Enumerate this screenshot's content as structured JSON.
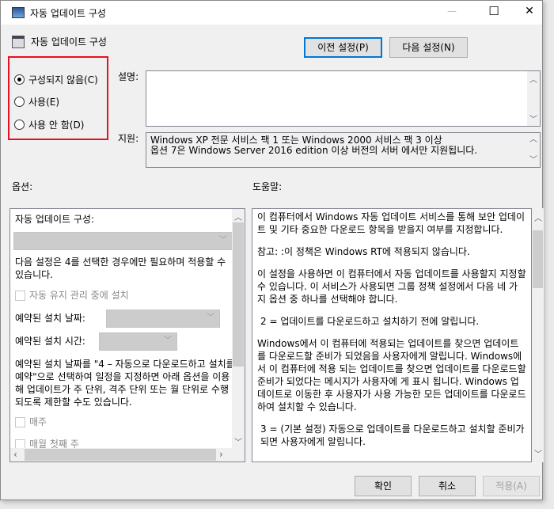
{
  "window": {
    "title": "자동 업데이트 구성",
    "minimize": "—",
    "maximize": "☐",
    "close": "✕"
  },
  "header": {
    "policy_name": "자동 업데이트 구성",
    "prev_button": "이전 설정(P)",
    "next_button": "다음 설정(N)"
  },
  "state": {
    "options": [
      {
        "label": "구성되지 않음(C)",
        "selected": true
      },
      {
        "label": "사용(E)",
        "selected": false
      },
      {
        "label": "사용 안 함(D)",
        "selected": false
      }
    ]
  },
  "description": {
    "label": "설명:",
    "value": ""
  },
  "support": {
    "label": "지원:",
    "lines": [
      "Windows XP 전문 서비스 팩 1 또는 Windows 2000 서비스 팩 3 이상",
      "옵션 7은 Windows Server 2016 edition 이상 버전의 서버 에서만 지원됩니다."
    ]
  },
  "options_panel": {
    "label": "옵션:",
    "configure_label": "자동 업데이트 구성:",
    "configure_value": "",
    "note": "다음 설정은 4를 선택한 경우에만 필요하며 적용할 수 있습니다.",
    "maintenance_checkbox": "자동 유지 관리 중에 설치",
    "install_day_label": "예약된 설치 날짜:",
    "install_time_label": "예약된 설치 시간:",
    "schedule_note": "예약된 설치 날짜를 \"4 – 자동으로 다운로드하고 설치를 예약\"으로 선택하여 일정을 지정하면 아래 옵션을 이용해 업데이트가 주 단위, 격주 단위 또는 월 단위로 수행되도록 제한할 수도 있습니다.",
    "weekly_checkbox": "매주",
    "first_week_checkbox": "매월 첫째 주"
  },
  "help_panel": {
    "label": "도움말:",
    "paragraphs": [
      "이 컴퓨터에서 Windows 자동 업데이트 서비스를 통해 보안 업데이트 및 기타 중요한 다운로드 항목을 받을지 여부를 지정합니다.",
      "참고: :이 정책은 Windows RT에 적용되지 않습니다.",
      "이 설정을 사용하면 이 컴퓨터에서 자동 업데이트를 사용할지 지정할 수 있습니다. 이 서비스가 사용되면 그룹 정책 설정에서 다음 네 가지 옵션 중 하나를 선택해야 합니다.",
      "2 = 업데이트를 다운로드하고 설치하기 전에 알립니다.",
      "Windows에서 이 컴퓨터에 적용되는 업데이트를 찾으면 업데이트를 다운로드할 준비가 되었음을 사용자에게 알립니다. Windows에서 이 컴퓨터에 적용 되는 업데이트를 찾으면 업데이트를 다운로드할 준비가 되었다는 메시지가 사용자에 게 표시 됩니다. Windows 업데이트로 이동한 후 사용자가 사용 가능한 모든 업데이트를 다운로드하여 설치할 수 있습니다.",
      "3 = (기본 설정) 자동으로 업데이트를 다운로드하고 설치할 준비가 되면 사용자에게 알립니다."
    ]
  },
  "footer": {
    "ok": "확인",
    "cancel": "취소",
    "apply": "적용(A)"
  },
  "colors": {
    "highlight_box": "#e81123",
    "accent": "#0078d7"
  }
}
